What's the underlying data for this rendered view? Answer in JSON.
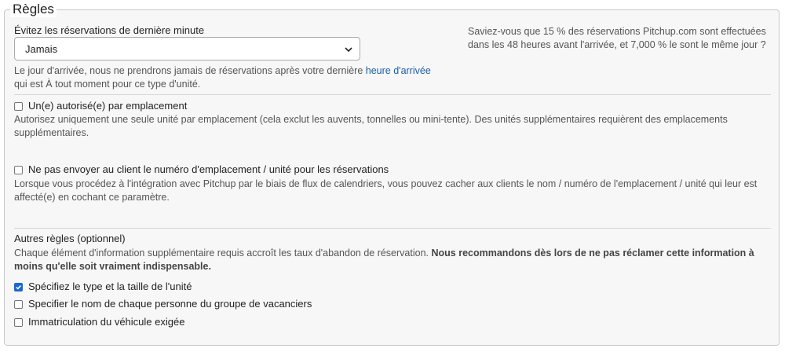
{
  "legend": "Règles",
  "last_minute": {
    "label": "Évitez les réservations de dernière minute",
    "select_value": "Jamais",
    "help_before_link": "Le jour d'arrivée, nous ne prendrons jamais de réservations après votre dernière",
    "help_link": "heure d'arrivée",
    "help_after_link": "qui est À tout moment pour ce type d'unité.",
    "side_note": "Saviez-vous que 15 % des réservations Pitchup.com sont effectuées dans les 48 heures avant l'arrivée, et 7,000 % le sont le même jour ?"
  },
  "one_unit": {
    "label": "Un(e) autorisé(e) par emplacement",
    "checked": false,
    "help": "Autorisez uniquement une seule unité par emplacement (cela exclut les auvents, tonnelles ou mini-tente). Des unités supplémentaires requièrent des emplacements supplémentaires."
  },
  "hide_pitch": {
    "label": "Ne pas envoyer au client le numéro d'emplacement / unité pour les réservations",
    "checked": false,
    "help": "Lorsque vous procédez à l'intégration avec Pitchup par le biais de flux de calendriers, vous pouvez cacher aux clients le nom / numéro de l'emplacement / unité qui leur est affecté(e) en cochant ce paramètre."
  },
  "other_rules": {
    "title": "Autres règles (optionnel)",
    "help_plain": "Chaque élément d'information supplémentaire requis accroît les taux d'abandon de réservation.",
    "help_bold": "Nous recommandons dès lors de ne pas réclamer cette information à moins qu'elle soit vraiment indispensable.",
    "options": [
      {
        "label": "Spécifiez le type et la taille de l'unité",
        "checked": true
      },
      {
        "label": "Specifier le nom de chaque personne du groupe de vacanciers",
        "checked": false
      },
      {
        "label": "Immatriculation du véhicule exigée",
        "checked": false
      }
    ]
  }
}
